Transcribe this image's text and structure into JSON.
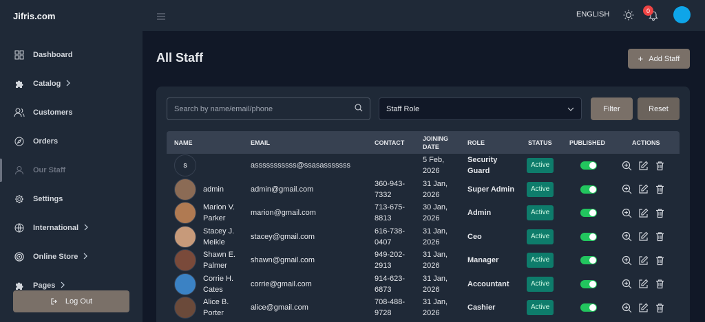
{
  "brand": "Jifris.com",
  "sidebar": {
    "items": [
      {
        "label": "Dashboard",
        "icon": "grid-icon",
        "chevron": false
      },
      {
        "label": "Catalog",
        "icon": "puzzle-icon",
        "chevron": true
      },
      {
        "label": "Customers",
        "icon": "users-icon",
        "chevron": false
      },
      {
        "label": "Orders",
        "icon": "compass-icon",
        "chevron": false
      },
      {
        "label": "Our Staff",
        "icon": "user-icon",
        "chevron": false,
        "active": true
      },
      {
        "label": "Settings",
        "icon": "gear-icon",
        "chevron": false
      },
      {
        "label": "International",
        "icon": "globe-icon",
        "chevron": true
      },
      {
        "label": "Online Store",
        "icon": "target-icon",
        "chevron": true
      },
      {
        "label": "Pages",
        "icon": "puzzle-icon",
        "chevron": true
      }
    ],
    "logout_label": "Log Out"
  },
  "topbar": {
    "language": "ENGLISH",
    "notification_count": "0"
  },
  "main": {
    "title": "All Staff",
    "add_button": "Add Staff",
    "search_placeholder": "Search by name/email/phone",
    "role_select": "Staff Role",
    "filter_button": "Filter",
    "reset_button": "Reset"
  },
  "table": {
    "headers": {
      "name": "NAME",
      "email": "EMAIL",
      "contact": "CONTACT",
      "joining_date": "JOINING DATE",
      "role": "ROLE",
      "status": "STATUS",
      "published": "PUBLISHED",
      "actions": "ACTIONS"
    },
    "rows": [
      {
        "initial": "S",
        "name": "",
        "email": "asssssssssss@ssasasssssss",
        "contact": "",
        "date": "5 Feb, 2026",
        "role": "Security Guard",
        "status": "Active",
        "avatar_color": "#1f2937"
      },
      {
        "initial": "",
        "name": "admin",
        "email": "admin@gmail.com",
        "contact": "360-943-7332",
        "date": "31 Jan, 2026",
        "role": "Super Admin",
        "status": "Active",
        "avatar_color": "#8b6b55"
      },
      {
        "initial": "",
        "name": "Marion V. Parker",
        "email": "marion@gmail.com",
        "contact": "713-675-8813",
        "date": "30 Jan, 2026",
        "role": "Admin",
        "status": "Active",
        "avatar_color": "#b07a52"
      },
      {
        "initial": "",
        "name": "Stacey J. Meikle",
        "email": "stacey@gmail.com",
        "contact": "616-738-0407",
        "date": "31 Jan, 2026",
        "role": "Ceo",
        "status": "Active",
        "avatar_color": "#c79a7a"
      },
      {
        "initial": "",
        "name": "Shawn E. Palmer",
        "email": "shawn@gmail.com",
        "contact": "949-202-2913",
        "date": "31 Jan, 2026",
        "role": "Manager",
        "status": "Active",
        "avatar_color": "#7a4a3a"
      },
      {
        "initial": "",
        "name": "Corrie H. Cates",
        "email": "corrie@gmail.com",
        "contact": "914-623-6873",
        "date": "31 Jan, 2026",
        "role": "Accountant",
        "status": "Active",
        "avatar_color": "#3b82c4"
      },
      {
        "initial": "",
        "name": "Alice B. Porter",
        "email": "alice@gmail.com",
        "contact": "708-488-9728",
        "date": "31 Jan, 2026",
        "role": "Cashier",
        "status": "Active",
        "avatar_color": "#6b4a3a"
      }
    ]
  }
}
